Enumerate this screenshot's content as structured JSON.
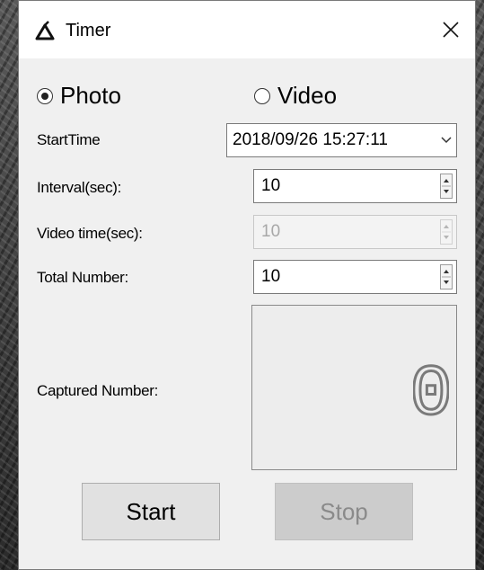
{
  "window": {
    "title": "Timer"
  },
  "mode": {
    "options": [
      {
        "label": "Photo",
        "selected": true
      },
      {
        "label": "Video",
        "selected": false
      }
    ]
  },
  "fields": {
    "start_time": {
      "label": "StartTime",
      "value": "2018/09/26 15:27:11"
    },
    "interval": {
      "label": "Interval(sec):",
      "value": "10",
      "enabled": true
    },
    "video_time": {
      "label": "Video time(sec):",
      "value": "10",
      "enabled": false
    },
    "total_number": {
      "label": "Total Number:",
      "value": "10",
      "enabled": true
    },
    "captured_number": {
      "label": "Captured Number:",
      "value": "0"
    }
  },
  "buttons": {
    "start": {
      "label": "Start",
      "enabled": true
    },
    "stop": {
      "label": "Stop",
      "enabled": false
    }
  },
  "icons": {
    "title": "timer-app-icon",
    "close": "close-icon",
    "dropdown": "chevron-down-icon",
    "spinner": "spin-arrows-icon"
  },
  "colors": {
    "counter_digit": "#7a7a7a",
    "disabled_text": "#a8a8a8"
  }
}
